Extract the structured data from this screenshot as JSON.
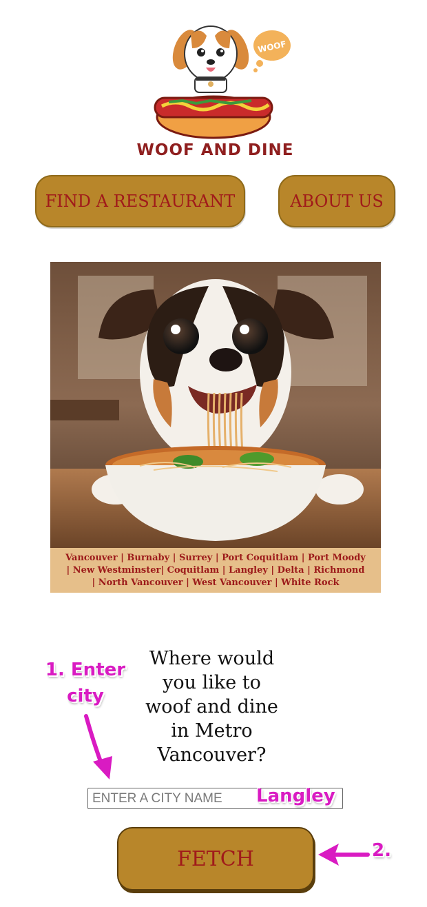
{
  "brand": {
    "name": "WOOF AND DINE",
    "bubble_text": "WOOF"
  },
  "nav": {
    "find_label": "FIND A RESTAURANT",
    "about_label": "ABOUT US"
  },
  "hero": {
    "cities_text": "Vancouver | Burnaby | Surrey | Port Coquitlam | Port Moody | New Westminster| Coquitlam | Langley | Delta | Richmond | North Vancouver | West Vancouver | White Rock"
  },
  "search": {
    "question": "Where would you like to woof and dine in Metro Vancouver?",
    "placeholder": "ENTER A CITY NAME",
    "button_label": "FETCH"
  },
  "annotations": {
    "step1_label": "1. Enter city",
    "typed_value": "Langley",
    "step2_label": "2."
  },
  "colors": {
    "button_fill": "#b8862a",
    "button_text": "#a01a1a",
    "annotation": "#d91bc2",
    "cities_band": "#e6bf8a"
  }
}
